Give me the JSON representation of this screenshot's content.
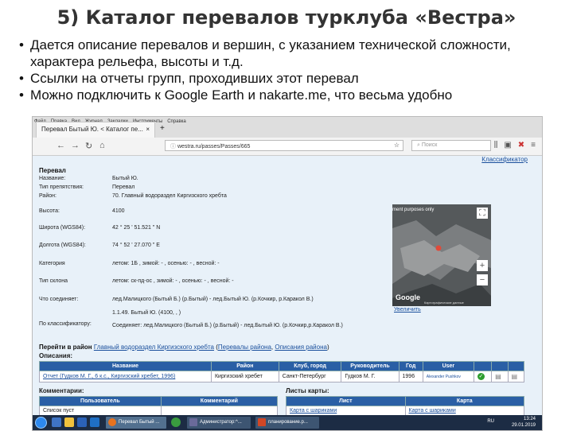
{
  "slide": {
    "title": "5) Каталог перевалов турклуба «Вестра»",
    "bullets": [
      "Дается описание перевалов и вершин, с указанием технической сложности, характера рельефа, высоты и т.д.",
      "Ссылки на отчеты групп, проходивших этот перевал",
      "Можно подключить к Google Earth и nakarte.me, что весьма удобно"
    ]
  },
  "browser": {
    "tab_title": "Перевал Бытый Ю. < Каталог пе...",
    "menu": [
      "Файл",
      "Правка",
      "Вид",
      "Журнал",
      "Закладки",
      "Инструменты",
      "Справка"
    ],
    "url": "westra.ru/passes/Passes/665",
    "search_placeholder": "Поиск",
    "colors": {
      "header_blue": "#2a5fa5",
      "link": "#1a4f9c",
      "page_bg": "#e8f1f9"
    }
  },
  "page": {
    "classifier_link": "Классификатор",
    "section_title": "Перевал",
    "props": [
      {
        "label": "Название:",
        "value": "Бытый Ю."
      },
      {
        "label": "Тип препятствия:",
        "value": "Перевал"
      },
      {
        "label": "Район:",
        "value": "70. Главный водораздел Киргизского хребта"
      },
      {
        "label": "Высота:",
        "value": "4100"
      },
      {
        "label": "Широта (WGS84):",
        "value": "42 ° 25 ' 51.521 \" N"
      },
      {
        "label": "Долгота (WGS84):",
        "value": "74 ° 52 ' 27.070 \" E"
      },
      {
        "label": "Категория",
        "value": "летом: 1Б , зимой: - , осенью: - , весной: -"
      },
      {
        "label": "Тип склона",
        "value": "летом: ск-пд-ос , зимой: - , осенью: - , весной: -"
      },
      {
        "label": "Что соединяет:",
        "value": "лед.Малицкого (Бытый Б.) (р.Бытый) - лед.Бытый Ю. (р.Кочкир, р.Каракол В.)"
      },
      {
        "label": "",
        "value": "1.1.49. Бытый Ю. (4100, , )"
      },
      {
        "label": "По классификатору:",
        "value": "Соединяет: лед.Малицкого (Бытый Б.) (р.Бытый) - лед.Бытый Ю. (р.Кочкир,р.Каракол В.)"
      }
    ],
    "map": {
      "note": "ment purposes only",
      "logo": "Google",
      "data_text": "Картографические данные",
      "zoom_link": "Увеличить",
      "zoom_in": "+",
      "zoom_out": "−"
    },
    "goto": {
      "prefix": "Перейти в район",
      "link1": "Главный водораздел Киргизского хребта",
      "link2": "Перевалы района",
      "link3": "Описания района"
    },
    "descriptions_label": "Описания:",
    "desc_table": {
      "headers": [
        "Название",
        "Район",
        "Клуб, город",
        "Руководитель",
        "Год",
        "User",
        "",
        "",
        ""
      ],
      "rows": [
        {
          "name": "Отчет (Гудков М. Г., 6 к.с., Киргизский хребет, 1996)",
          "region": "Киргизский хребет",
          "club": "Санкт-Петербург",
          "leader": "Гудков М. Г.",
          "year": "1996",
          "user": "Alexander Pushkov"
        }
      ]
    },
    "comments_label": "Комментарии:",
    "comments_table": {
      "headers": [
        "Пользователь",
        "Комментарий"
      ],
      "rows": [
        [
          "Список пуст",
          ""
        ]
      ]
    },
    "sheets_label": "Листы карты:",
    "sheets_table": {
      "headers": [
        "Лист",
        "Карта"
      ],
      "rows": [
        [
          "Карта с шариками",
          "Карта с шариками"
        ]
      ]
    }
  },
  "taskbar": {
    "items": [
      "Перевал Бытый ...",
      "Администратор:^...",
      "планирование.р..."
    ],
    "lang": "RU",
    "time": "13:24",
    "date": "29.01.2019"
  }
}
